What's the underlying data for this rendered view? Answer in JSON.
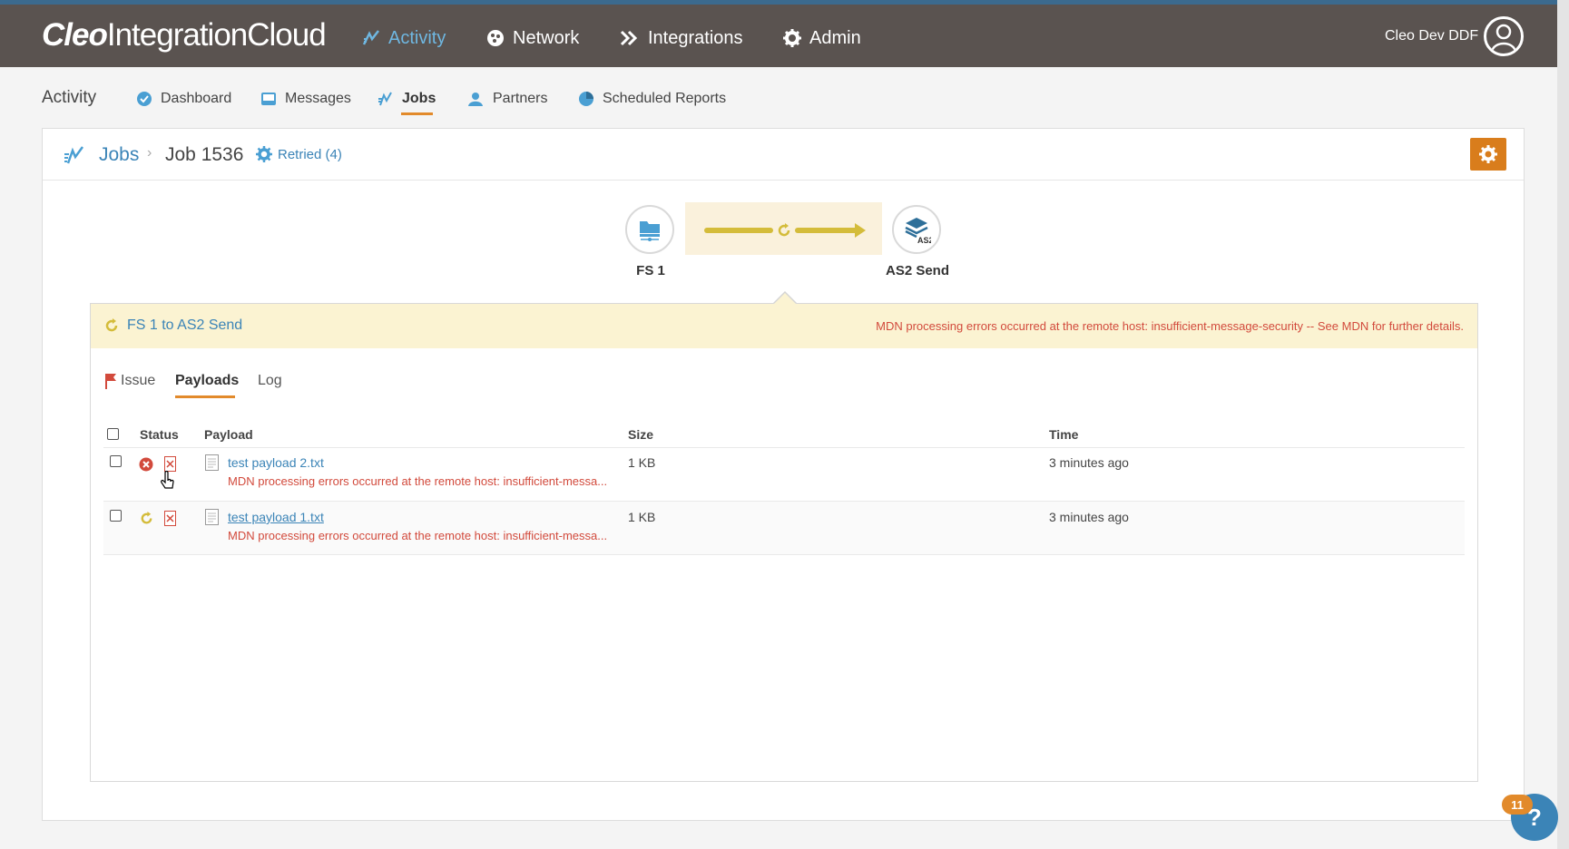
{
  "app": {
    "logo_brand": "Cleo",
    "logo_product": "IntegrationCloud",
    "user_name": "Cleo Dev DDF"
  },
  "nav": [
    {
      "label": "Activity",
      "icon": "activity-icon",
      "active": true
    },
    {
      "label": "Network",
      "icon": "network-icon",
      "active": false
    },
    {
      "label": "Integrations",
      "icon": "integrations-icon",
      "active": false
    },
    {
      "label": "Admin",
      "icon": "gear-icon",
      "active": false
    }
  ],
  "subnav": {
    "title": "Activity",
    "items": [
      {
        "label": "Dashboard",
        "icon": "dashboard-icon"
      },
      {
        "label": "Messages",
        "icon": "inbox-icon"
      },
      {
        "label": "Jobs",
        "icon": "jobs-icon",
        "active": true
      },
      {
        "label": "Partners",
        "icon": "partners-icon"
      },
      {
        "label": "Scheduled Reports",
        "icon": "reports-icon"
      }
    ]
  },
  "breadcrumb": {
    "jobs": "Jobs",
    "job": "Job 1536",
    "status": "Retried (4)"
  },
  "flow": {
    "source": "FS 1",
    "target": "AS2 Send",
    "target_badge": "AS2"
  },
  "detail": {
    "title": "FS 1 to AS2 Send",
    "message": "MDN processing errors occurred at the remote host: insufficient-message-security -- See MDN for further details.",
    "tabs": [
      {
        "label": "Issue",
        "active": false
      },
      {
        "label": "Payloads",
        "active": true
      },
      {
        "label": "Log",
        "active": false
      }
    ],
    "columns": [
      "Status",
      "Payload",
      "Size",
      "Time"
    ],
    "rows": [
      {
        "status": "error",
        "payload": "test payload 2.txt",
        "error": "MDN processing errors occurred at the remote host: insufficient-messa...",
        "size": "1 KB",
        "time": "3 minutes ago"
      },
      {
        "status": "retrying",
        "payload": "test payload 1.txt",
        "error": "MDN processing errors occurred at the remote host: insufficient-messa...",
        "size": "1 KB",
        "time": "3 minutes ago"
      }
    ]
  },
  "help": {
    "badge": "11",
    "label": "?"
  },
  "colors": {
    "topbar": "#5a5350",
    "accent_blue": "#3b84b7",
    "accent_orange": "#e28a2b",
    "error_red": "#d24a3c",
    "flow_yellow": "#d4bc3a"
  }
}
